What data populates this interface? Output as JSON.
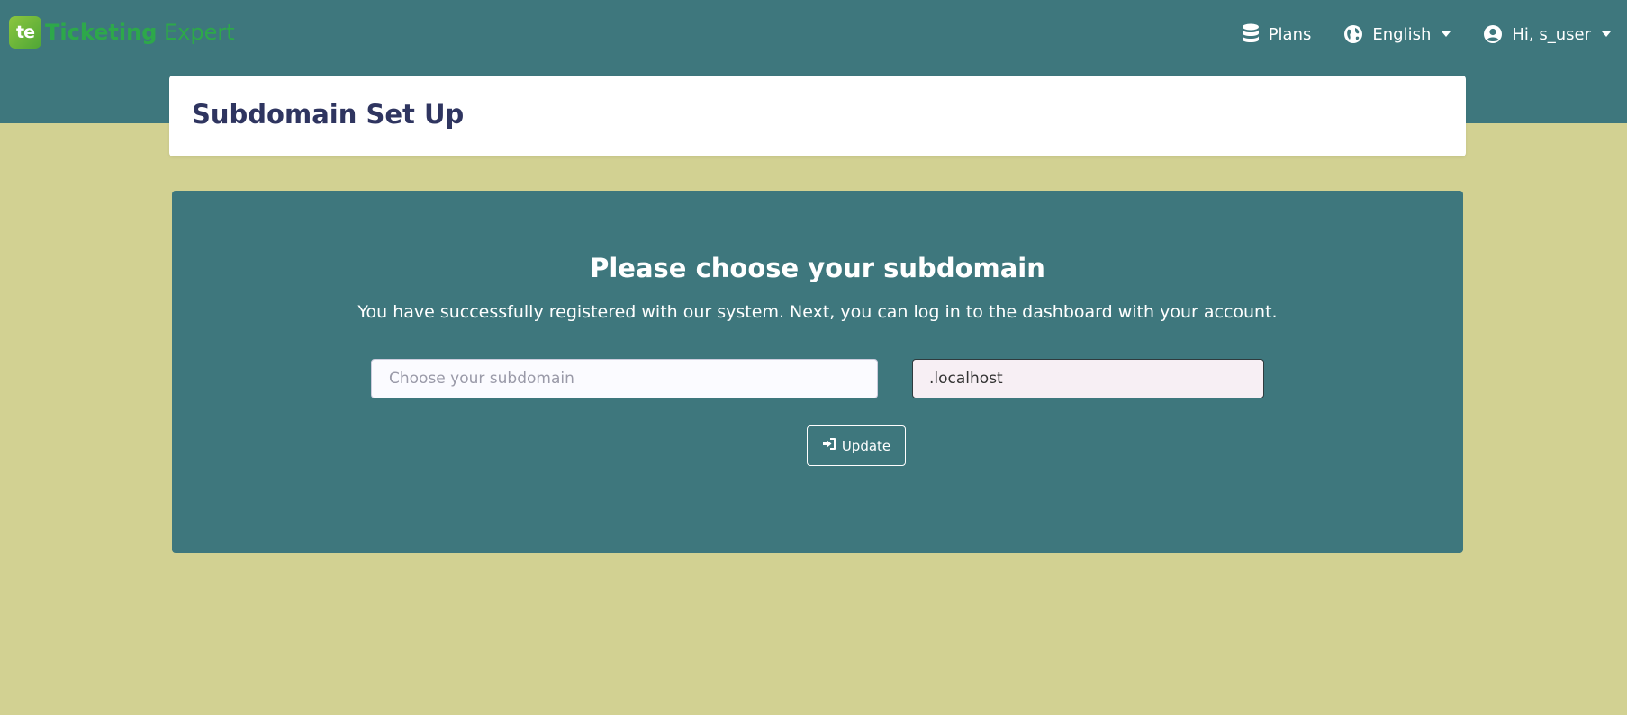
{
  "brand": {
    "badge": "te",
    "name_bold": "Ticketing",
    "name_light": " Expert"
  },
  "nav": {
    "plans_label": "Plans",
    "language_label": "English",
    "user_label": "Hi, s_user"
  },
  "header": {
    "title": "Subdomain Set Up"
  },
  "panel": {
    "title": "Please choose your subdomain",
    "description": "You have successfully registered with our system. Next, you can log in to the dashboard with your account.",
    "subdomain_placeholder": "Choose your subdomain",
    "subdomain_value": "",
    "suffix_value": ".localhost",
    "update_label": "Update"
  },
  "icons": {
    "plans": "database-icon",
    "language": "globe-icon",
    "user": "user-circle-icon",
    "update": "sign-in-icon"
  },
  "colors": {
    "navbar": "#3e777d",
    "page_background": "#d2d192",
    "panel": "#3e777d",
    "brand_green": "#2da84a",
    "title_text": "#2f3560"
  }
}
